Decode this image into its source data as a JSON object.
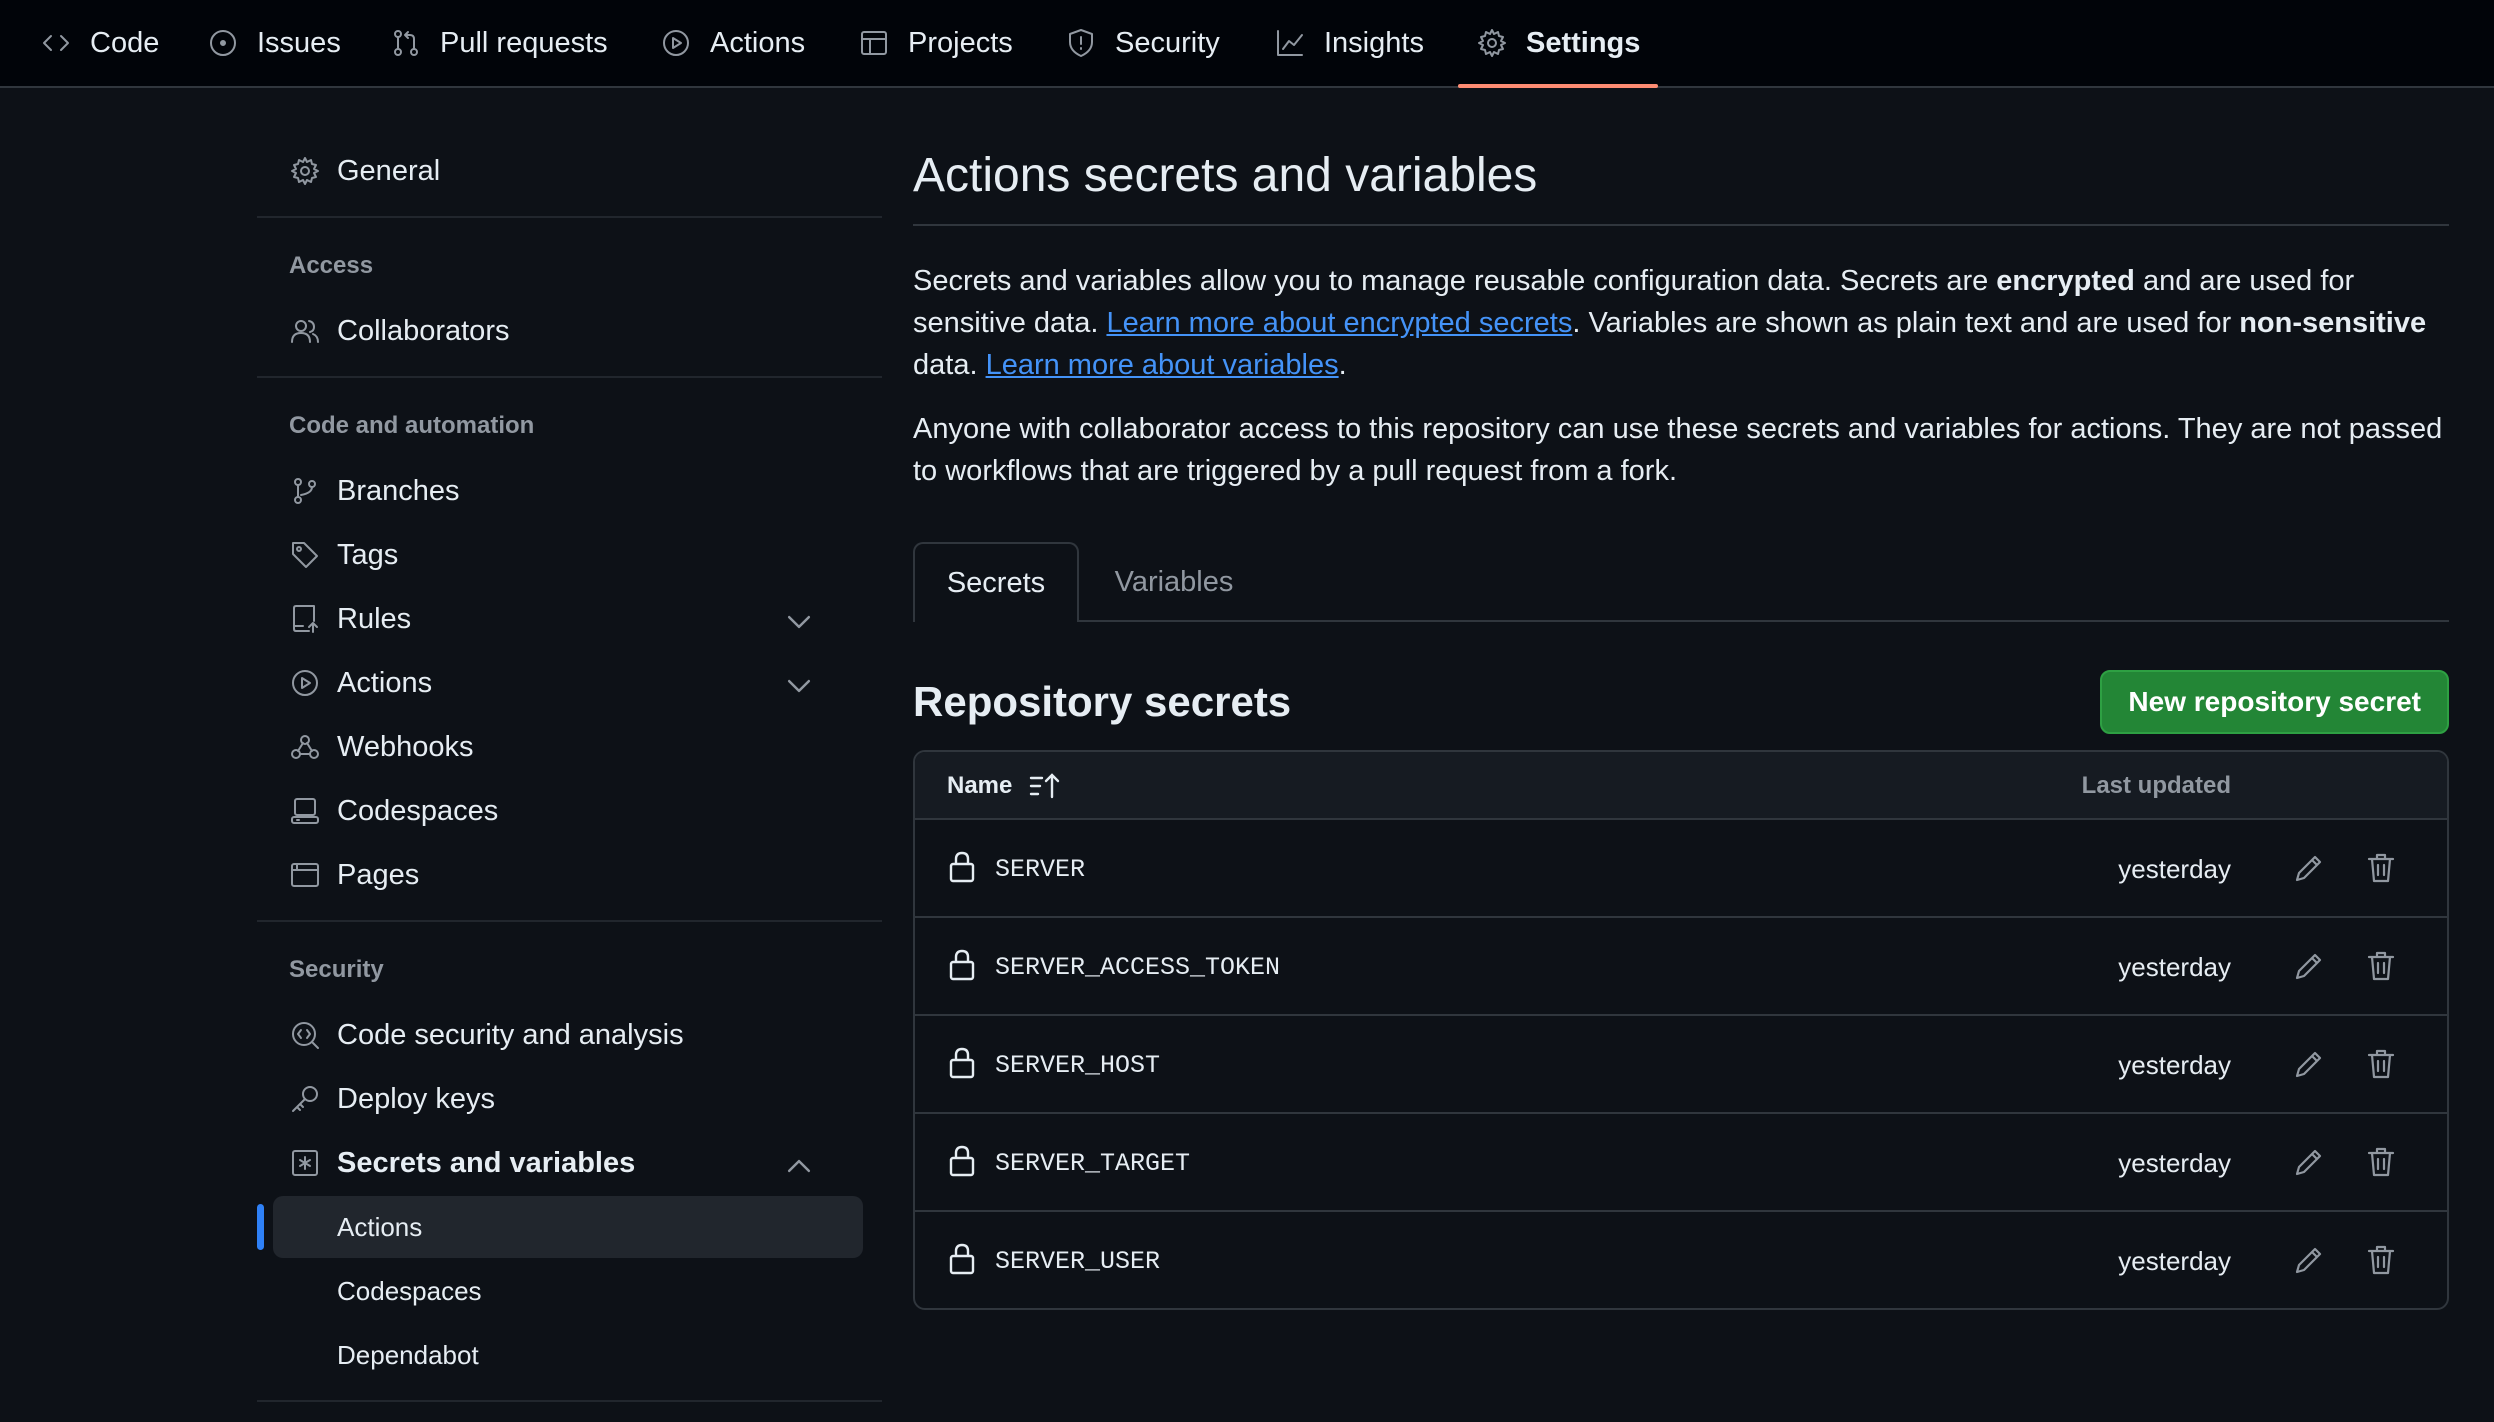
{
  "topnav": {
    "items": [
      {
        "label": "Code",
        "icon": "code-icon"
      },
      {
        "label": "Issues",
        "icon": "issue-icon"
      },
      {
        "label": "Pull requests",
        "icon": "pull-request-icon"
      },
      {
        "label": "Actions",
        "icon": "play-icon"
      },
      {
        "label": "Projects",
        "icon": "table-icon"
      },
      {
        "label": "Security",
        "icon": "shield-icon"
      },
      {
        "label": "Insights",
        "icon": "graph-icon"
      },
      {
        "label": "Settings",
        "icon": "gear-icon",
        "active": true
      }
    ]
  },
  "sidebar": {
    "general": "General",
    "access_heading": "Access",
    "collaborators": "Collaborators",
    "code_heading": "Code and automation",
    "branches": "Branches",
    "tags": "Tags",
    "rules": "Rules",
    "actions": "Actions",
    "webhooks": "Webhooks",
    "codespaces": "Codespaces",
    "pages": "Pages",
    "security_heading": "Security",
    "code_security": "Code security and analysis",
    "deploy_keys": "Deploy keys",
    "secrets_vars": "Secrets and variables",
    "sub": {
      "actions": "Actions",
      "codespaces": "Codespaces",
      "dependabot": "Dependabot"
    }
  },
  "main": {
    "title": "Actions secrets and variables",
    "desc1": {
      "a": "Secrets and variables allow you to manage reusable configuration data. Secrets are ",
      "b": "encrypted",
      "c": " and are used for sensitive data. ",
      "link1": "Learn more about encrypted secrets",
      "d": ". Variables are shown as plain text and are used for ",
      "e": "non-sensitive",
      "f": " data. ",
      "link2": "Learn more about variables",
      "g": "."
    },
    "desc2": "Anyone with collaborator access to this repository can use these secrets and variables for actions. They are not passed to workflows that are triggered by a pull request from a fork.",
    "tabs": {
      "secrets": "Secrets",
      "variables": "Variables"
    },
    "section_title": "Repository secrets",
    "new_button": "New repository secret",
    "table": {
      "col_name": "Name",
      "col_updated": "Last updated",
      "rows": [
        {
          "name": "SERVER",
          "updated": "yesterday"
        },
        {
          "name": "SERVER_ACCESS_TOKEN",
          "updated": "yesterday"
        },
        {
          "name": "SERVER_HOST",
          "updated": "yesterday"
        },
        {
          "name": "SERVER_TARGET",
          "updated": "yesterday"
        },
        {
          "name": "SERVER_USER",
          "updated": "yesterday"
        }
      ]
    }
  },
  "colors": {
    "accent": "#2f81f7",
    "active_tab_underline": "#fd8c73",
    "primary_button": "#238636",
    "link": "#4493f8"
  }
}
